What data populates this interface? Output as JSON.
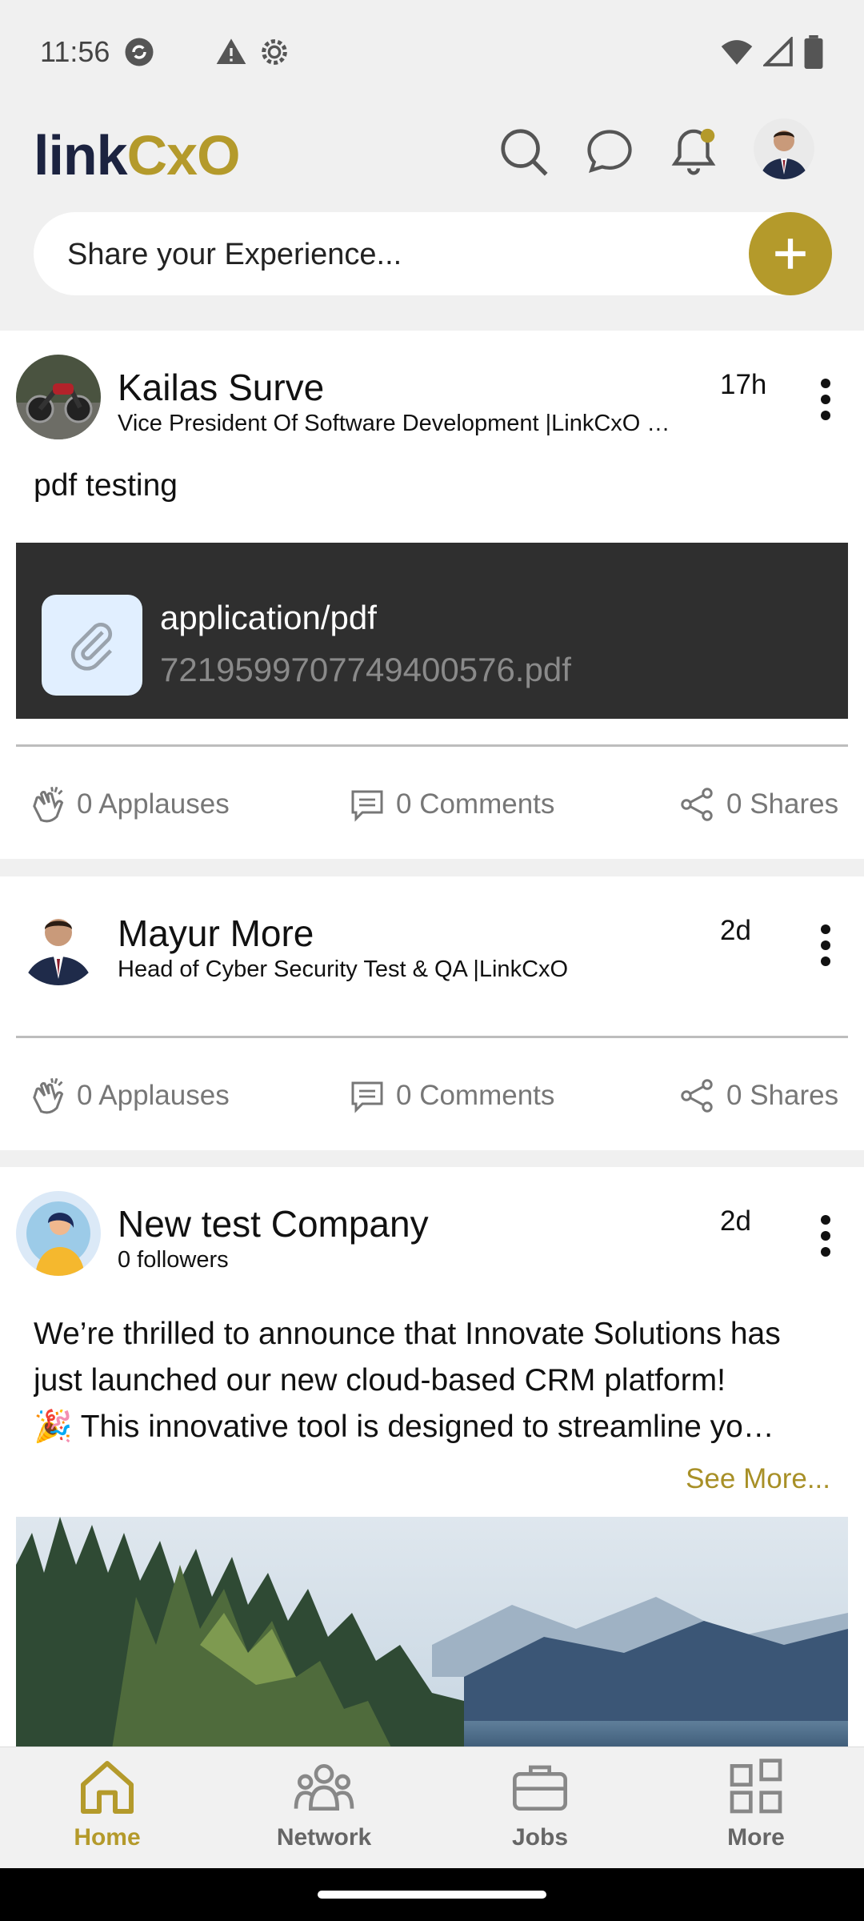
{
  "status_bar": {
    "time": "11:56"
  },
  "header": {
    "logo_part1": "link",
    "logo_part2": "CxO"
  },
  "share": {
    "placeholder": "Share your Experience..."
  },
  "posts": [
    {
      "author": "Kailas Surve",
      "subtitle": "Vice President Of Software Development |LinkCxO …",
      "time": "17h",
      "text": "pdf testing",
      "attachment": {
        "type": "application/pdf",
        "filename": "7219599707749400576.pdf"
      },
      "applauses": "0 Applauses",
      "comments": "0 Comments",
      "shares": "0 Shares"
    },
    {
      "author": "Mayur More",
      "subtitle": "Head of Cyber Security Test & QA |LinkCxO",
      "time": "2d",
      "applauses": "0 Applauses",
      "comments": "0 Comments",
      "shares": "0 Shares"
    },
    {
      "author": "New test Company",
      "subtitle": "0 followers",
      "time": "2d",
      "text_lines": [
        "We’re thrilled to announce that Innovate Solutions has",
        "just launched our new cloud-based CRM platform!",
        "🎉 This innovative tool is designed to streamline yo…"
      ],
      "see_more": "See More..."
    }
  ],
  "bottom_nav": [
    {
      "label": "Home",
      "icon": "home-icon",
      "active": true
    },
    {
      "label": "Network",
      "icon": "network-icon",
      "active": false
    },
    {
      "label": "Jobs",
      "icon": "briefcase-icon",
      "active": false
    },
    {
      "label": "More",
      "icon": "grid-icon",
      "active": false
    }
  ],
  "colors": {
    "accent": "#b49a2b",
    "logo_dark": "#1c2340",
    "background": "#f0f0f0"
  }
}
